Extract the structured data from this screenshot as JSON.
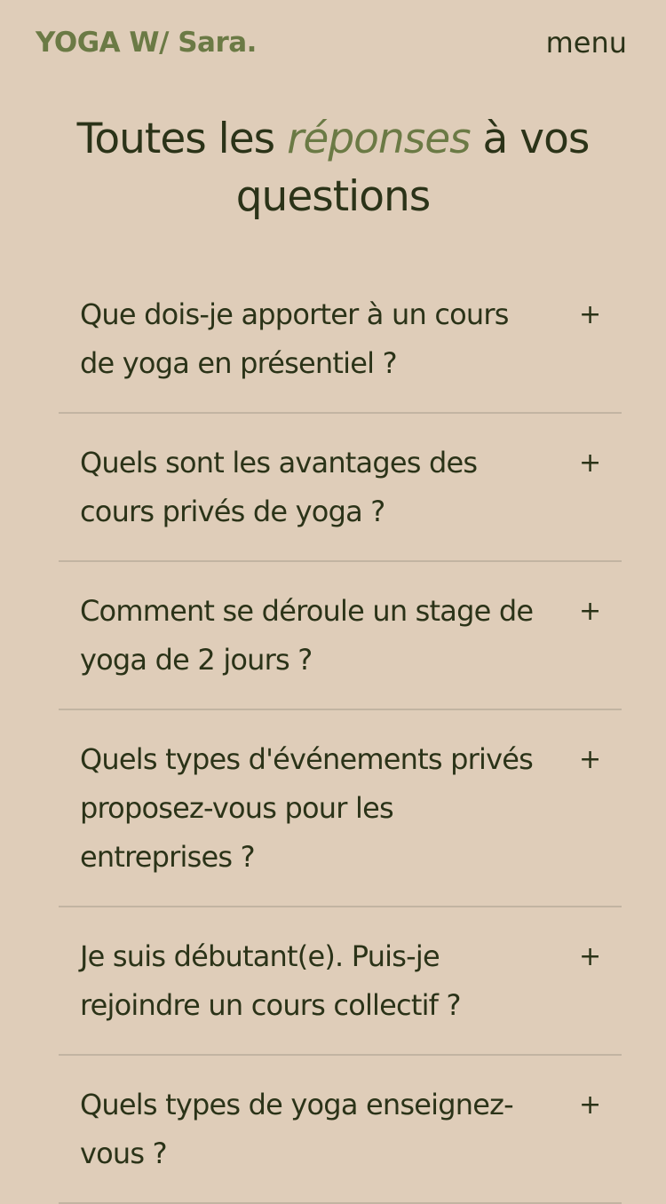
{
  "colors": {
    "background": "#dfcdb9",
    "text": "#2b3318",
    "accent": "#6b7a45",
    "divider": "#c2b4a2"
  },
  "header": {
    "brand": "YOGA W/ Sara.",
    "menu_label": "menu"
  },
  "main": {
    "title_before": "Toutes les ",
    "title_accent": "réponses",
    "title_after": " à vos questions"
  },
  "faq": {
    "toggle_icon": "plus-icon",
    "toggle_glyph": "+",
    "items": [
      {
        "question": "Que dois-je apporter à un cours de yoga en présentiel ?"
      },
      {
        "question": "Quels sont les avantages des cours privés de yoga ?"
      },
      {
        "question": "Comment se déroule un stage de yoga de 2 jours ?"
      },
      {
        "question": "Quels types d'événements privés proposez-vous pour les entreprises ?"
      },
      {
        "question": "Je suis débutant(e). Puis-je rejoindre un cours collectif ?"
      },
      {
        "question": "Quels types de yoga enseignez-vous ?"
      }
    ]
  }
}
